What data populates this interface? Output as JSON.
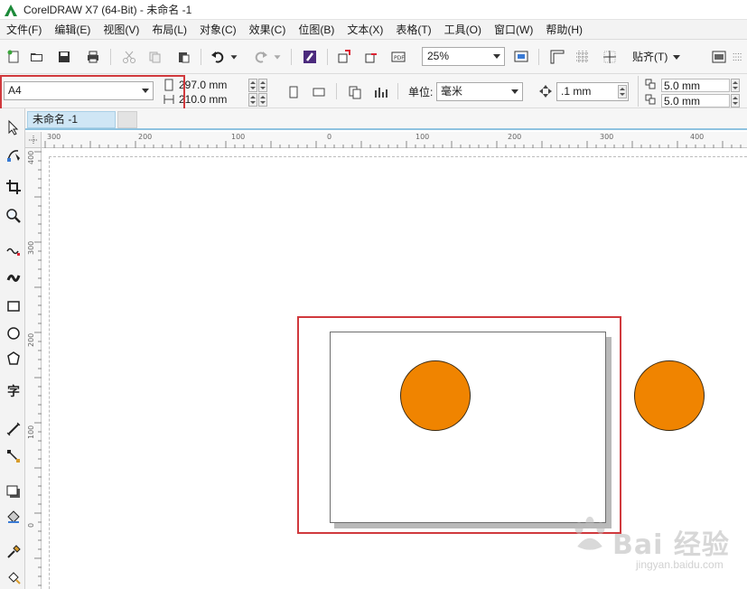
{
  "window": {
    "title": "CorelDRAW X7 (64-Bit) - 未命名 -1"
  },
  "menu": [
    "文件(F)",
    "编辑(E)",
    "视图(V)",
    "布局(L)",
    "对象(C)",
    "效果(C)",
    "位图(B)",
    "文本(X)",
    "表格(T)",
    "工具(O)",
    "窗口(W)",
    "帮助(H)"
  ],
  "toolbar": {
    "zoom_value": "25%",
    "snap_label": "贴齐(T)"
  },
  "property_bar": {
    "page_size": "A4",
    "page_height": "297.0 mm",
    "page_width": "210.0 mm",
    "unit_label": "单位:",
    "unit_value": "毫米",
    "nudge_value": ".1 mm",
    "dup_x": "5.0 mm",
    "dup_y": "5.0 mm"
  },
  "document": {
    "tab_name": "未命名 -1"
  },
  "ruler": {
    "h_labels": [
      "300",
      "200",
      "100",
      "0",
      "100",
      "200",
      "300",
      "400"
    ],
    "v_labels": [
      "400",
      "300",
      "200",
      "100",
      "0"
    ]
  },
  "shapes": {
    "circle_fill": "#f08400"
  },
  "watermark": {
    "main": "Bai 经验",
    "sub": "jingyan.baidu.com"
  },
  "colors": {
    "highlight": "#d0393d",
    "tab_accent": "#8fc3e0"
  }
}
